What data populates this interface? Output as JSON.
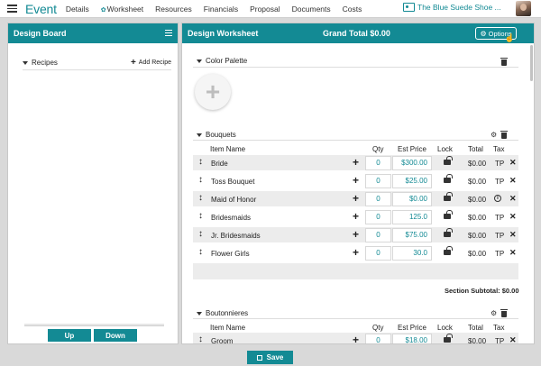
{
  "app": {
    "brand": "Event",
    "nav": [
      {
        "label": "Details"
      },
      {
        "label": "Worksheet",
        "icon": "leaf-icon"
      },
      {
        "label": "Resources"
      },
      {
        "label": "Financials"
      },
      {
        "label": "Proposal"
      },
      {
        "label": "Documents"
      },
      {
        "label": "Costs"
      }
    ],
    "client_name": "The Blue Suede Shoe ..."
  },
  "design_board": {
    "title": "Design Board",
    "recipes_label": "Recipes",
    "add_recipe_label": "Add Recipe",
    "up_label": "Up",
    "down_label": "Down"
  },
  "worksheet": {
    "title": "Design Worksheet",
    "grand_total": "Grand Total $0.00",
    "options_label": "Options",
    "color_palette_label": "Color Palette",
    "columns": {
      "item_name": "Item Name",
      "qty": "Qty",
      "est_price": "Est Price",
      "lock": "Lock",
      "total": "Total",
      "tax": "Tax"
    },
    "bouquets": {
      "title": "Bouquets",
      "rows": [
        {
          "name": "Bride",
          "qty": "0",
          "price": "$300.00",
          "total": "$0.00",
          "tax": "TP"
        },
        {
          "name": "Toss Bouquet",
          "qty": "0",
          "price": "$25.00",
          "total": "$0.00",
          "tax": "TP"
        },
        {
          "name": "Maid of Honor",
          "qty": "0",
          "price": "$0.00",
          "total": "$0.00",
          "tax": "i"
        },
        {
          "name": "Bridesmaids",
          "qty": "0",
          "price": "125.0",
          "total": "$0.00",
          "tax": "TP"
        },
        {
          "name": "Jr. Bridesmaids",
          "qty": "0",
          "price": "$75.00",
          "total": "$0.00",
          "tax": "TP"
        },
        {
          "name": "Flower Girls",
          "qty": "0",
          "price": "30.0",
          "total": "$0.00",
          "tax": "TP"
        }
      ],
      "subtotal": "Section Subtotal: $0.00"
    },
    "boutonnieres": {
      "title": "Boutonnieres",
      "rows": [
        {
          "name": "Groom",
          "qty": "0",
          "price": "$18.00",
          "total": "$0.00",
          "tax": "TP"
        }
      ]
    }
  },
  "footer": {
    "save_label": "Save"
  },
  "colors": {
    "accent": "#138a94",
    "row_alt": "#ececec",
    "background": "#d9d9d9"
  }
}
